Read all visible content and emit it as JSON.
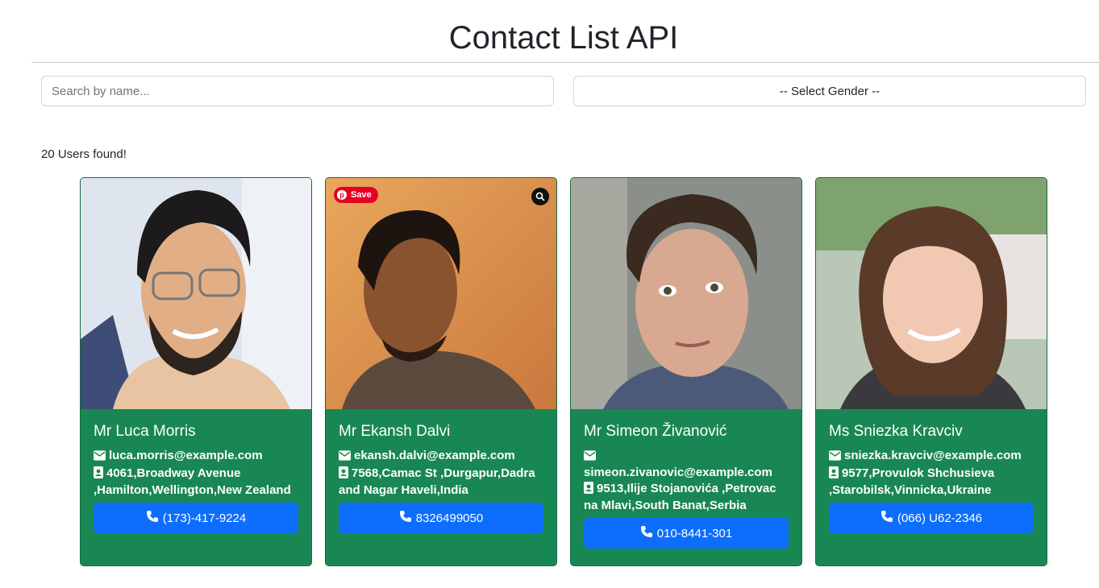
{
  "header": {
    "title": "Contact List API"
  },
  "filters": {
    "search_placeholder": "Search by name...",
    "gender_select": "-- Select Gender --"
  },
  "results": {
    "count_text": "20 Users found!"
  },
  "overlay": {
    "pin_save_label": "Save"
  },
  "colors": {
    "card_bg": "#198754",
    "button_bg": "#0d6efd",
    "pin_red": "#e60023"
  },
  "icons": {
    "email": "envelope-icon",
    "address": "address-card-icon",
    "phone": "phone-icon",
    "lens": "visual-search-icon"
  },
  "cards": [
    {
      "name": "Mr Luca Morris",
      "email": "luca.morris@example.com",
      "address": "4061,Broadway Avenue ,Hamilton,Wellington,New Zealand",
      "phone": "(173)-417-9224"
    },
    {
      "name": "Mr Ekansh Dalvi",
      "email": "ekansh.dalvi@example.com",
      "address": "7568,Camac St ,Durgapur,Dadra and Nagar Haveli,India",
      "phone": "8326499050"
    },
    {
      "name": "Mr Simeon Živanović",
      "email": "simeon.zivanovic@example.com",
      "address": "9513,Ilije Stojanovića ,Petrovac na Mlavi,South Banat,Serbia",
      "phone": "010-8441-301"
    },
    {
      "name": "Ms Sniezka Kravciv",
      "email": "sniezka.kravciv@example.com",
      "address": "9577,Provulok Shchusieva ,Starobilsk,Vinnicka,Ukraine",
      "phone": "(066) U62-2346"
    }
  ]
}
